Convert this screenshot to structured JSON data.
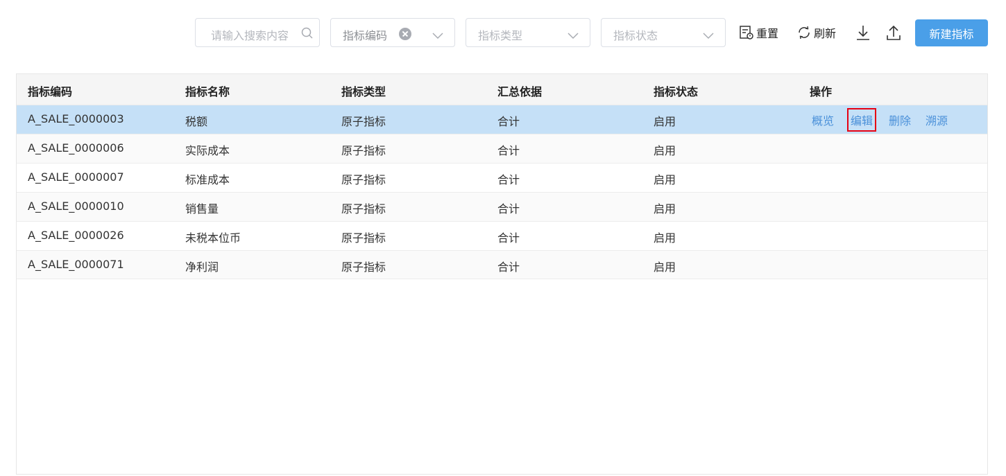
{
  "toolbar": {
    "search_placeholder": "请输入搜索内容",
    "filter_code": {
      "value": "指标编码"
    },
    "filter_type": {
      "placeholder": "指标类型"
    },
    "filter_status": {
      "placeholder": "指标状态"
    },
    "reset_label": "重置",
    "refresh_label": "刷新",
    "new_label": "新建指标"
  },
  "table": {
    "headers": [
      "指标编码",
      "指标名称",
      "指标类型",
      "汇总依据",
      "指标状态",
      "操作"
    ],
    "rows": [
      [
        "A_SALE_0000003",
        "税额",
        "原子指标",
        "合计",
        "启用"
      ],
      [
        "A_SALE_0000006",
        "实际成本",
        "原子指标",
        "合计",
        "启用"
      ],
      [
        "A_SALE_0000007",
        "标准成本",
        "原子指标",
        "合计",
        "启用"
      ],
      [
        "A_SALE_0000010",
        "销售量",
        "原子指标",
        "合计",
        "启用"
      ],
      [
        "A_SALE_0000026",
        "未税本位币",
        "原子指标",
        "合计",
        "启用"
      ],
      [
        "A_SALE_0000071",
        "净利润",
        "原子指标",
        "合计",
        "启用"
      ]
    ],
    "row_actions": [
      "概览",
      "编辑",
      "删除",
      "溯源"
    ]
  },
  "colors": {
    "primary": "#4a9fe8",
    "selected_row": "#c5e0f7",
    "link": "#4a90d9",
    "highlight": "#e60012"
  }
}
